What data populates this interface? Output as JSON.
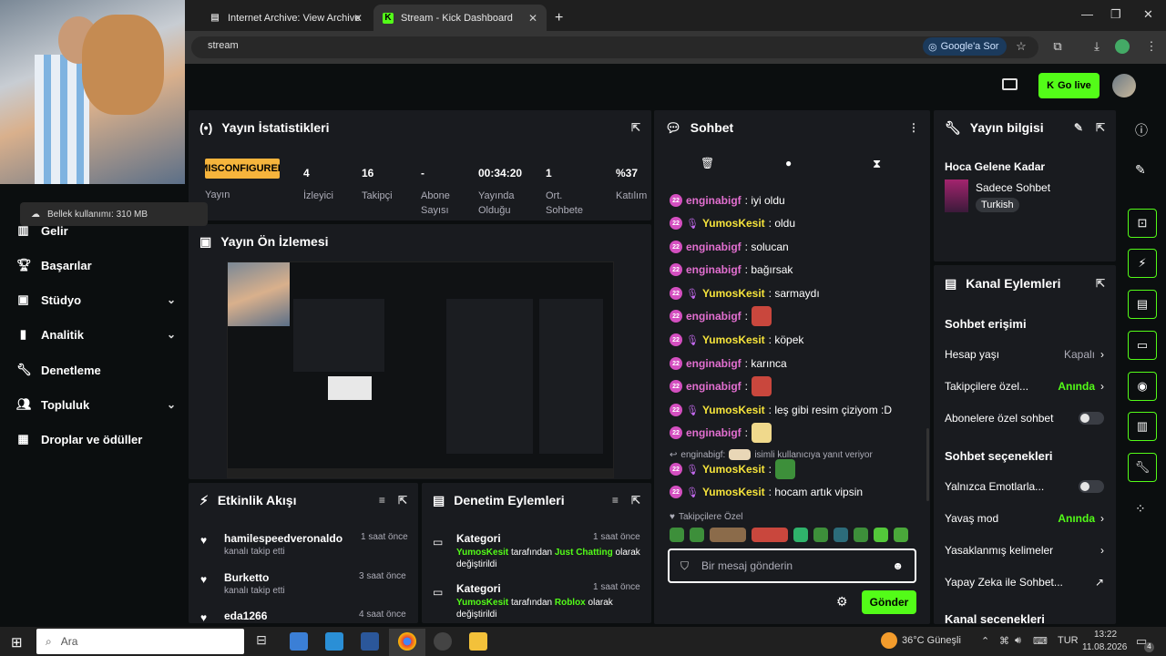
{
  "browser": {
    "tabs": [
      {
        "title": "Internet Archive: View Archive",
        "active": false
      },
      {
        "title": "Stream - Kick Dashboard",
        "active": true
      }
    ],
    "new_tab": "+",
    "url": "stream",
    "google_sor": "Google'a Sor"
  },
  "overlay": {
    "memory_tip": "Bellek kullanımı: 310 MB"
  },
  "header": {
    "go_live": "Go live"
  },
  "sidebar": {
    "items": [
      {
        "label": "Gelir",
        "icon": "dollar-icon",
        "chevron": false
      },
      {
        "label": "Başarılar",
        "icon": "trophy-icon",
        "chevron": false
      },
      {
        "label": "Stüdyo",
        "icon": "studio-icon",
        "chevron": true
      },
      {
        "label": "Analitik",
        "icon": "chart-icon",
        "chevron": true
      },
      {
        "label": "Denetleme",
        "icon": "wrench-icon",
        "chevron": false
      },
      {
        "label": "Topluluk",
        "icon": "people-icon",
        "chevron": true
      },
      {
        "label": "Droplar ve ödüller",
        "icon": "gift-icon",
        "chevron": false
      }
    ]
  },
  "stats": {
    "title": "Yayın İstatistikleri",
    "status_badge": "MISCONFIGURED",
    "status_label": "Yayın",
    "items": [
      {
        "value": "4",
        "label": "İzleyici"
      },
      {
        "value": "16",
        "label": "Takipçi"
      },
      {
        "value": "-",
        "label": "Abone Sayısı"
      },
      {
        "value": "00:34:20",
        "label": "Yayında Olduğu Süre"
      },
      {
        "value": "1",
        "label": "Ort. Sohbete Katılanlar"
      },
      {
        "value": "%37",
        "label": "Katılım"
      }
    ]
  },
  "preview": {
    "title": "Yayın Ön İzlemesi"
  },
  "activity": {
    "title": "Etkinlik Akışı",
    "items": [
      {
        "name": "hamilespeedveronaldo",
        "action": "kanalı takip etti",
        "time": "1 saat önce"
      },
      {
        "name": "Burketto",
        "action": "kanalı takip etti",
        "time": "3 saat önce"
      },
      {
        "name": "eda1266",
        "action": "",
        "time": "4 saat önce"
      }
    ]
  },
  "moderation": {
    "title": "Denetim Eylemleri",
    "items": [
      {
        "title": "Kategori",
        "time": "1 saat önce",
        "user": "YumosKesit",
        "mid": "tarafından",
        "value": "Just Chatting",
        "tail": "olarak değiştirildi"
      },
      {
        "title": "Kategori",
        "time": "1 saat önce",
        "user": "YumosKesit",
        "mid": "tarafından",
        "value": "Roblox",
        "tail": "olarak değiştirildi"
      }
    ]
  },
  "chat": {
    "title": "Sohbet",
    "messages": [
      {
        "user": "enginabigf",
        "text": ": iyi oldu",
        "mic": false
      },
      {
        "user": "YumosKesit",
        "text": ": oldu",
        "mic": true
      },
      {
        "user": "enginabigf",
        "text": ": solucan",
        "mic": false
      },
      {
        "user": "enginabigf",
        "text": ": bağırsak",
        "mic": false
      },
      {
        "user": "YumosKesit",
        "text": ": sarmaydı",
        "mic": true
      },
      {
        "user": "enginabigf",
        "text": ":",
        "mic": false
      },
      {
        "user": "YumosKesit",
        "text": ": köpek",
        "mic": true
      },
      {
        "user": "enginabigf",
        "text": ": karınca",
        "mic": false
      },
      {
        "user": "enginabigf",
        "text": ":",
        "mic": false
      },
      {
        "user": "YumosKesit",
        "text": ": leş gibi resim çiziyom :D",
        "mic": true
      },
      {
        "user": "enginabigf",
        "text": ":",
        "mic": false
      }
    ],
    "reply_line": {
      "user": "enginabigf:",
      "text": "isimli kullanıcıya yanıt veriyor"
    },
    "messages2": [
      {
        "user": "YumosKesit",
        "text": ":",
        "mic": true
      },
      {
        "user": "YumosKesit",
        "text": ": hocam artık vipsin",
        "mic": true
      }
    ],
    "followers_only": "Takipçilere Özel",
    "input_placeholder": "Bir mesaj gönderin",
    "send": "Gönder",
    "badge_text": "22"
  },
  "stream_info": {
    "title": "Yayın bilgisi",
    "stream_title": "Hoca Gelene Kadar",
    "category": "Sadece Sohbet",
    "language": "Turkish"
  },
  "channel_actions": {
    "title": "Kanal Eylemleri",
    "section1": "Sohbet erişimi",
    "rows1": [
      {
        "label": "Hesap yaşı",
        "value": "Kapalı",
        "kind": "chev",
        "green": false
      },
      {
        "label": "Takipçilere özel...",
        "value": "Anında",
        "kind": "chev",
        "green": true
      },
      {
        "label": "Abonelere özel sohbet",
        "value": "",
        "kind": "toggle",
        "green": false
      }
    ],
    "section2": "Sohbet seçenekleri",
    "rows2": [
      {
        "label": "Yalnızca Emotlarla...",
        "value": "",
        "kind": "toggle",
        "green": false
      },
      {
        "label": "Yavaş mod",
        "value": "Anında",
        "kind": "chev",
        "green": true
      },
      {
        "label": "Yasaklanmış kelimeler",
        "value": "",
        "kind": "chev",
        "green": false
      },
      {
        "label": "Yapay Zeka ile Sohbet...",
        "value": "",
        "kind": "ext",
        "green": false
      }
    ],
    "section3": "Kanal seçenekleri"
  },
  "taskbar": {
    "search": "Ara",
    "weather": "36°C  Güneşli",
    "lang": "TUR",
    "time": "13:22",
    "date": "11.08.2026",
    "notif": "4"
  },
  "colors": {
    "accent": "#53fc18",
    "panel": "#191b1f",
    "bg": "#0b0e0f"
  }
}
